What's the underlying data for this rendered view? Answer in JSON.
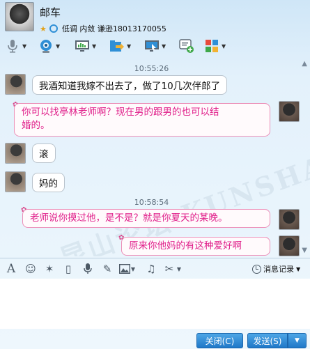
{
  "contact": {
    "name": "邮车",
    "signature": "低调  内敛  谦逊18013170055"
  },
  "toolbar": {
    "icons": [
      "microphone-icon",
      "video-camera-icon",
      "screen-share-icon",
      "file-transfer-icon",
      "remote-assist-icon",
      "message-add-icon",
      "app-grid-icon"
    ]
  },
  "chat": {
    "timestamps": [
      "10:55:26",
      "10:58:54"
    ],
    "messages": [
      {
        "from": "peer",
        "text": "我酒知道我嫁不出去了，做了10几次伴郎了"
      },
      {
        "from": "self",
        "line1": "你可以找亭林老师啊？现在男的跟男的也可以结",
        "line2": "婚的。"
      },
      {
        "from": "peer",
        "text": "滚"
      },
      {
        "from": "peer",
        "text": "妈的"
      },
      {
        "from": "self",
        "text": "老师说你摸过他，是不是？就是你夏天的某晚。"
      },
      {
        "from": "self",
        "text": "原来你他妈的有这种爱好啊"
      }
    ],
    "watermark": "昆山论坛 KUNSHAN BBS"
  },
  "input_toolbar": {
    "history_label": "消息记录"
  },
  "buttons": {
    "close": "关闭(C)",
    "send": "发送(S)"
  },
  "colors": {
    "accent": "#1f78c8",
    "self_text": "#e01f8a",
    "self_border": "#ec8fb8"
  }
}
